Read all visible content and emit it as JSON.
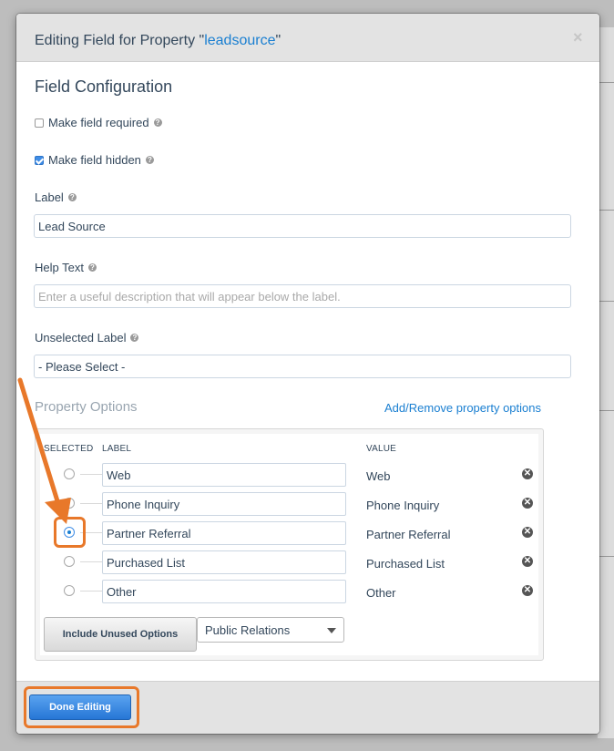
{
  "modal": {
    "title_prefix": "Editing Field for Property \"",
    "property_name": "leadsource",
    "title_suffix": "\"",
    "close_glyph": "×"
  },
  "config": {
    "section_title": "Field Configuration",
    "make_required": {
      "label": "Make field required",
      "checked": false
    },
    "make_hidden": {
      "label": "Make field hidden",
      "checked": true
    },
    "label_field": {
      "label": "Label",
      "value": "Lead Source"
    },
    "help_text_field": {
      "label": "Help Text",
      "placeholder": "Enter a useful description that will appear below the label."
    },
    "unselected_label_field": {
      "label": "Unselected Label",
      "value": "- Please Select -"
    },
    "help_glyph": "?"
  },
  "property_options": {
    "title": "Property Options",
    "add_remove_link": "Add/Remove property options",
    "headers": {
      "selected": "SELECTED",
      "label": "LABEL",
      "value": "VALUE"
    },
    "options": [
      {
        "label": "Web",
        "value": "Web",
        "selected": false
      },
      {
        "label": "Phone Inquiry",
        "value": "Phone Inquiry",
        "selected": false
      },
      {
        "label": "Partner Referral",
        "value": "Partner Referral",
        "selected": true
      },
      {
        "label": "Purchased List",
        "value": "Purchased List",
        "selected": false
      },
      {
        "label": "Other",
        "value": "Other",
        "selected": false
      }
    ],
    "remove_glyph": "✕",
    "include_unused_button": "Include Unused Options",
    "unused_select_value": "Public Relations"
  },
  "footer": {
    "done_button": "Done Editing"
  },
  "colors": {
    "accent": "#1a7fd1",
    "annotation": "#e8782a"
  }
}
